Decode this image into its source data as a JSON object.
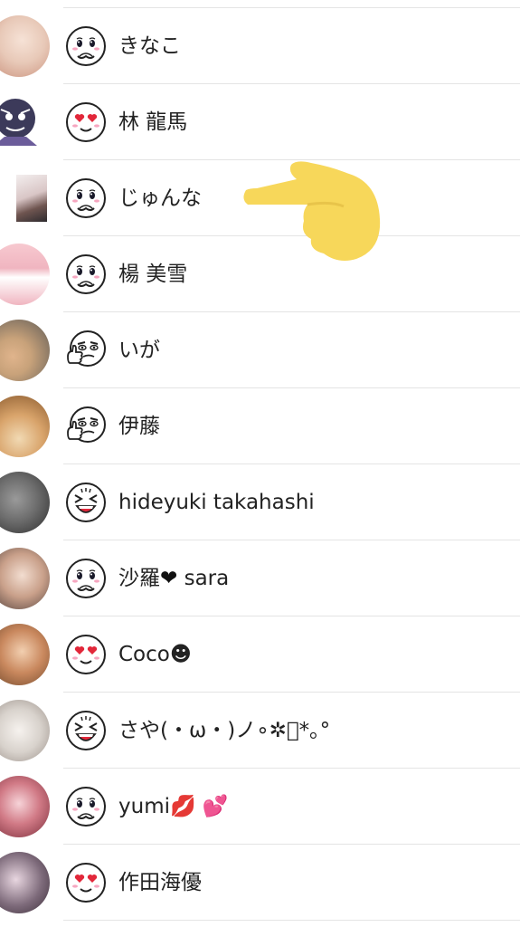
{
  "friends": [
    {
      "name": "きなこ",
      "sticker": "shy-face-icon",
      "avatar_color": "#e8c9b8"
    },
    {
      "name": "林 龍馬",
      "sticker": "heart-eyes-face-icon",
      "avatar_color": "#3c3a5a"
    },
    {
      "name": "じゅんな",
      "sticker": "shy-face-icon",
      "avatar_color": "#d9c6c6"
    },
    {
      "name": "楊 美雪",
      "sticker": "shy-face-icon",
      "avatar_color": "#f0b5c0"
    },
    {
      "name": "いが",
      "sticker": "thumbs-up-face-icon",
      "avatar_color": "#c8a27a"
    },
    {
      "name": "伊藤",
      "sticker": "thumbs-up-face-icon",
      "avatar_color": "#d9a46b"
    },
    {
      "name": "hideyuki takahashi",
      "sticker": "laughing-face-icon",
      "avatar_color": "#6d6d6d"
    },
    {
      "name_prefix": "沙羅",
      "name_heart": "❤",
      "name_suffix": " sara",
      "sticker": "shy-face-icon",
      "avatar_color": "#c9a08a"
    },
    {
      "name": "Coco☻",
      "sticker": "heart-eyes-face-icon",
      "avatar_color": "#c9885e"
    },
    {
      "name": "さや(・ω・)ノ∘✲ﾟ*｡°",
      "sticker": "laughing-face-icon",
      "avatar_color": "#d8d2cc"
    },
    {
      "name": "yumi💋 💕",
      "sticker": "shy-face-icon",
      "avatar_color": "#d17a86"
    },
    {
      "name": "作田海優",
      "sticker": "heart-eyes-face-icon",
      "avatar_color": "#7d6a7a"
    }
  ],
  "colors": {
    "pointer": "#f7d75a",
    "divider": "#e4e4e4",
    "text": "#222222"
  }
}
